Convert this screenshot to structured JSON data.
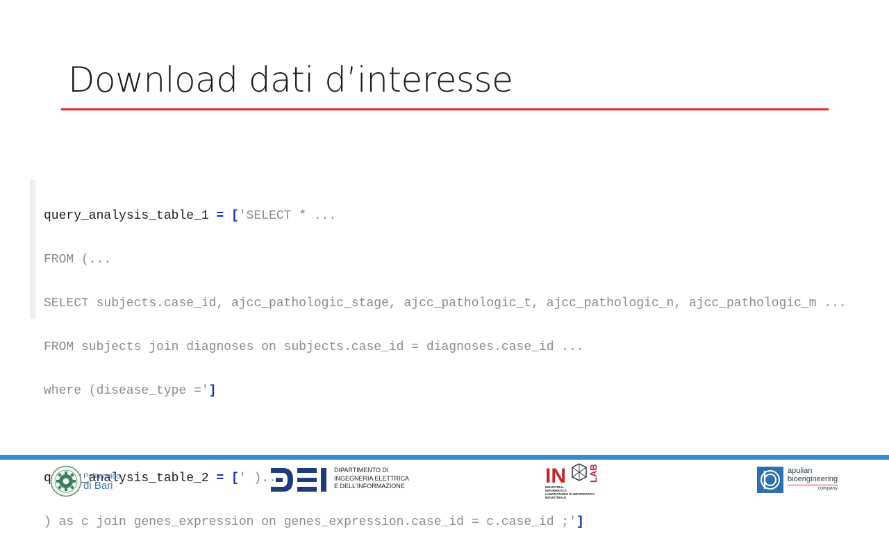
{
  "slide": {
    "title": "Download dati d’interesse"
  },
  "code": {
    "line1": {
      "var": "query_analysis_table_1 ",
      "op": "= [",
      "str": "'SELECT * ..."
    },
    "line2": "FROM (...",
    "line3": "SELECT subjects.case_id, ajcc_pathologic_stage, ajcc_pathologic_t, ajcc_pathologic_n, ajcc_pathologic_m ...",
    "line4": "FROM subjects join diagnoses on subjects.case_id = diagnoses.case_id ...",
    "line5": {
      "str": "where (disease_type ='",
      "op": "]"
    },
    "line6": {
      "var": "query_analysis_table_2 ",
      "op": "= [",
      "str": "' )..."
    },
    "line7": {
      "str": ") as c join genes_expression on genes_expression.case_id = c.case_id ;'",
      "op": "]"
    }
  },
  "footer": {
    "poliba": {
      "line1": "Politecnico",
      "line2": "di Bari"
    },
    "dei": {
      "mark": "DEI",
      "line1": "DIPARTIMENTO DI",
      "line2": "INGEGNERIA ELETTRICA",
      "line3": "E DELL'INFORMAZIONE"
    },
    "indlab": {
      "mark": "IND",
      "lab": "LAB",
      "sub1": "INDUSTRIAL",
      "sub2": "INFORMATICS",
      "sub3": "LABORATORIO DI INFORMATICA INDUSTRIALE"
    },
    "apulian": {
      "line1": "apulian",
      "line2": "bioengineering",
      "line3": "company"
    }
  },
  "colors": {
    "title_rule": "#e0262d",
    "footer_bar": "#2e8fcf",
    "code_operator": "#0d2fb3",
    "code_string": "#8a8a8a"
  }
}
